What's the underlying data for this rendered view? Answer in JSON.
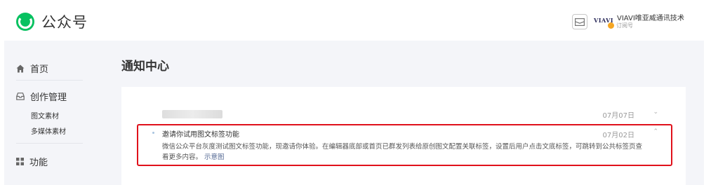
{
  "header": {
    "app_name": "公众号",
    "brand_mark": "VIAVI",
    "account_name": "VIAVI唯亚威通讯技术",
    "account_type": "订阅号",
    "colors": {
      "accent": "#07c160",
      "badge": "#f5a623"
    }
  },
  "sidebar": {
    "home": "首页",
    "creation": "创作管理",
    "creation_items": [
      "图文素材",
      "多媒体素材"
    ],
    "functions": "功能"
  },
  "main": {
    "page_title": "通知中心",
    "messages": [
      {
        "title": "",
        "date": "07月07日",
        "caret": "⌄"
      },
      {
        "title": "邀请你试用图文标签功能",
        "date": "07月02日",
        "caret": "⌃",
        "body": "微信公众平台灰度测试图文标签功能，现邀请你体验。在编辑器底部或首页已群发列表给原创图文配置关联标签，设置后用户点击文底标签，可跳转到公共标签页查看更多内容。",
        "link": "示意图"
      }
    ],
    "highlight_color": "#e0111b"
  }
}
